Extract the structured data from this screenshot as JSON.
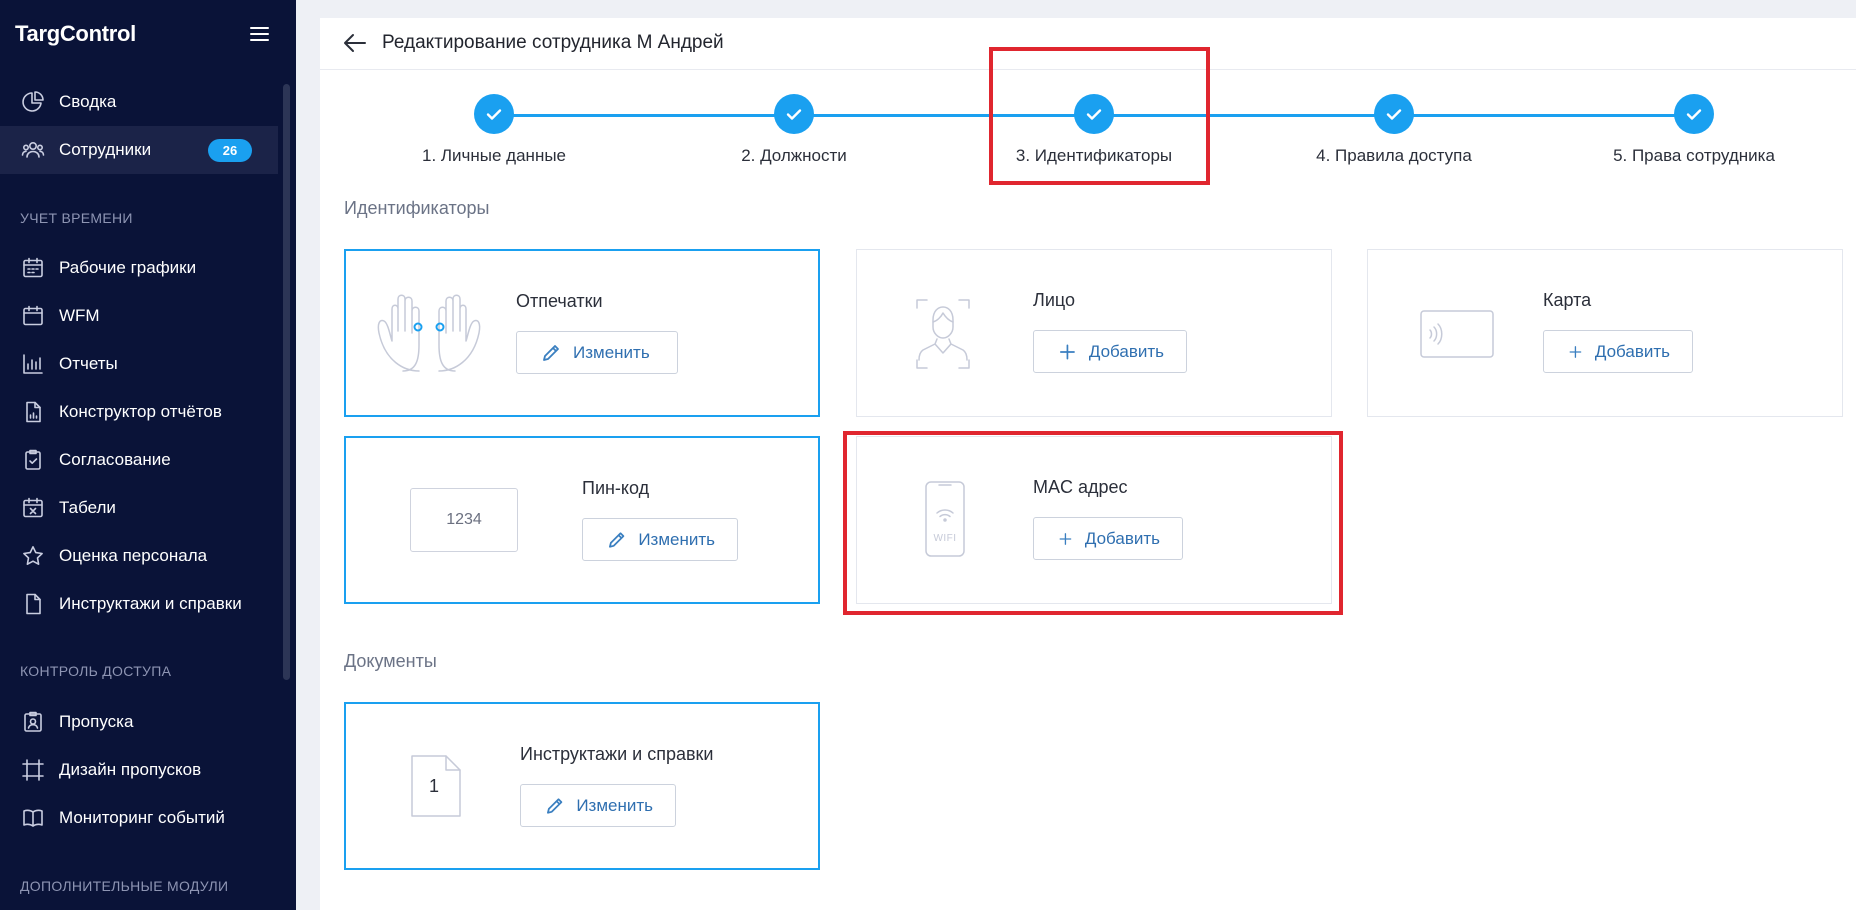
{
  "sidebar": {
    "logo": "TargControl",
    "items": [
      {
        "label": "Сводка"
      },
      {
        "label": "Сотрудники",
        "badge": "26"
      },
      {
        "label": "Рабочие графики"
      },
      {
        "label": "WFM"
      },
      {
        "label": "Отчеты"
      },
      {
        "label": "Конструктор отчётов"
      },
      {
        "label": "Согласование"
      },
      {
        "label": "Табели"
      },
      {
        "label": "Оценка персонала"
      },
      {
        "label": "Инструктажи и справки"
      },
      {
        "label": "Пропуска"
      },
      {
        "label": "Дизайн пропусков"
      },
      {
        "label": "Мониторинг событий"
      }
    ],
    "sections": [
      "УЧЕТ ВРЕМЕНИ",
      "КОНТРОЛЬ ДОСТУПА",
      "ДОПОЛНИТЕЛЬНЫЕ МОДУЛИ"
    ]
  },
  "header": {
    "title": "Редактирование сотрудника М Андрей"
  },
  "stepper": {
    "steps": [
      {
        "label": "1. Личные данные"
      },
      {
        "label": "2. Должности"
      },
      {
        "label": "3. Идентификаторы"
      },
      {
        "label": "4. Правила доступа"
      },
      {
        "label": "5. Права сотрудника"
      }
    ]
  },
  "identifiers": {
    "heading": "Идентификаторы",
    "cards": {
      "fingerprints": {
        "title": "Отпечатки",
        "button": "Изменить"
      },
      "face": {
        "title": "Лицо",
        "button": "Добавить"
      },
      "card": {
        "title": "Карта",
        "button": "Добавить"
      },
      "pin": {
        "title": "Пин-код",
        "button": "Изменить",
        "preview": "1234"
      },
      "mac": {
        "title": "MAC адрес",
        "button": "Добавить",
        "preview": "WIFI"
      }
    }
  },
  "documents": {
    "heading": "Документы",
    "card": {
      "title": "Инструктажи и справки",
      "button": "Изменить",
      "count": "1"
    }
  },
  "colors": {
    "sidebar_bg": "#0a1338",
    "accent": "#1aa0f0",
    "highlight": "#e0262f"
  }
}
